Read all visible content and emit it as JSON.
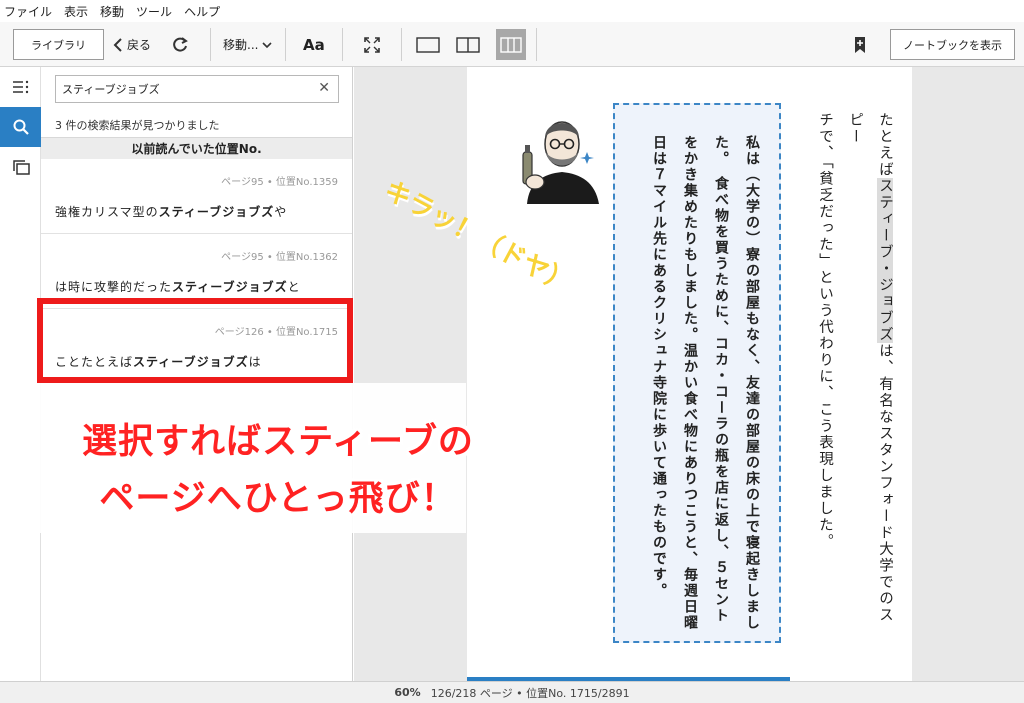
{
  "menu": [
    "ファイル",
    "表示",
    "移動",
    "ツール",
    "ヘルプ"
  ],
  "toolbar": {
    "library": "ライブラリ",
    "back": "戻る",
    "goto": "移動...",
    "font": "Aa",
    "notebook": "ノートブックを表示"
  },
  "search": {
    "value": "スティーブジョブズ",
    "result_count": "3 件の検索結果が見つかりました",
    "section": "以前読んでいた位置No."
  },
  "results": [
    {
      "meta": "ページ95 • 位置No.1359",
      "before": "強権カリスマ型の",
      "match": "スティーブジョブズ",
      "after": "や"
    },
    {
      "meta": "ページ95 • 位置No.1362",
      "before": "は時に攻撃的だった",
      "match": "スティーブジョブズ",
      "after": "と"
    },
    {
      "meta": "ページ126 • 位置No.1715",
      "before": "ことたとえば",
      "match": "スティーブジョブズ",
      "after": "は"
    }
  ],
  "annotation": {
    "line1": "選択すればスティーブの",
    "line2": "ページへひとっ飛び！",
    "kira": "キラッ！（ドヤ）"
  },
  "book": {
    "line1_pre": "たとえば",
    "line1_hl": "スティーブ・ジョブズ",
    "line1_post": "は、有名なスタンフォード大学でのスピー",
    "line2": "チで、「貧乏だった」という代わりに、こう表現しました。",
    "quote": "私は（大学の）寮の部屋もなく、友達の部屋の床の上で寝起きしました。　食べ物を買うために、コカ・コーラの瓶を店に返し、５セントをかき集めたりもしました。温かい食べ物にありつこうと、毎週日曜日は７マイル先にあるクリシュナ寺院に歩いて通ったものです。"
  },
  "status": {
    "zoom": "60%",
    "position": "126/218 ページ • 位置No. 1715/2891",
    "progress_fraction": 0.58
  },
  "colors": {
    "accent": "#2a7fc4",
    "highlight_frame": "#ee1b1b",
    "annotation_text": "#ff2222",
    "kira": "#f8d338"
  }
}
